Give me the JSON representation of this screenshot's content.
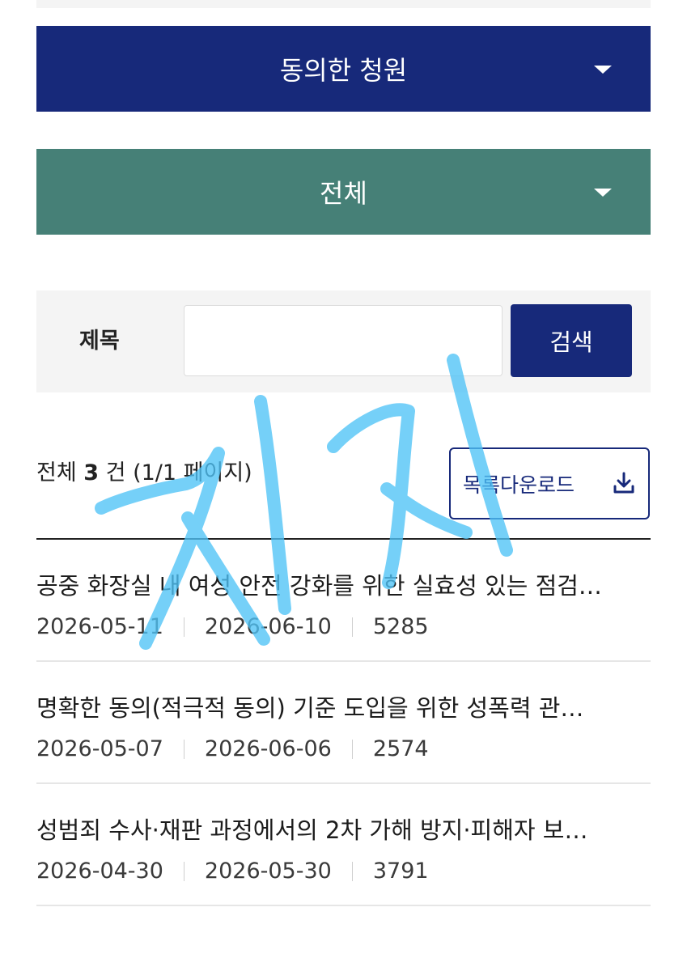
{
  "filters": {
    "category_label": "동의한 청원",
    "status_label": "전체"
  },
  "search": {
    "field_label": "제목",
    "value": "",
    "button_label": "검색"
  },
  "results": {
    "prefix": "전체 ",
    "count": "3",
    "suffix": " 건 (1/1 페이지)",
    "download_label": "목록다운로드"
  },
  "petitions": [
    {
      "title": "공중 화장실 내 여성 안전 강화를 위한 실효성 있는 점검…",
      "start_date": "2026-05-11",
      "end_date": "2026-06-10",
      "agree_count": "5285"
    },
    {
      "title": "명확한 동의(적극적 동의) 기준 도입을 위한 성폭력 관…",
      "start_date": "2026-05-07",
      "end_date": "2026-06-06",
      "agree_count": "2574"
    },
    {
      "title": "성범죄 수사·재판 과정에서의 2차 가해 방지·피해자 보…",
      "start_date": "2026-04-30",
      "end_date": "2026-05-30",
      "agree_count": "3791"
    }
  ],
  "annotation": {
    "handwritten_text": "지지",
    "color": "#4fc3f7"
  },
  "colors": {
    "primary_navy": "#17297a",
    "teal": "#468077",
    "panel_gray": "#f4f4f4"
  },
  "icons": {
    "dropdown": "caret-down-icon",
    "download": "download-icon"
  }
}
